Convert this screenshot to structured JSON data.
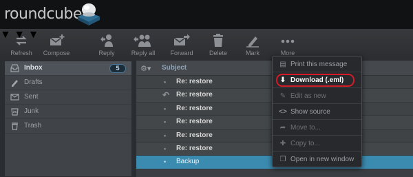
{
  "header": {
    "logo_text": "roundcube"
  },
  "toolbar": {
    "buttons": [
      {
        "label": "Refresh",
        "icon": "refresh-icon"
      },
      {
        "label": "Compose",
        "icon": "compose-icon"
      },
      {
        "label": "Reply",
        "icon": "reply-icon"
      },
      {
        "label": "Reply all",
        "icon": "reply-all-icon"
      },
      {
        "label": "Forward",
        "icon": "forward-icon"
      },
      {
        "label": "Delete",
        "icon": "trash-icon"
      },
      {
        "label": "Mark",
        "icon": "mark-icon"
      },
      {
        "label": "More",
        "icon": "more-icon"
      }
    ]
  },
  "folders": [
    {
      "label": "Inbox",
      "icon": "inbox-icon",
      "badge": "5",
      "selected": true
    },
    {
      "label": "Drafts",
      "icon": "drafts-icon"
    },
    {
      "label": "Sent",
      "icon": "sent-icon"
    },
    {
      "label": "Junk",
      "icon": "junk-icon"
    },
    {
      "label": "Trash",
      "icon": "trash-icon"
    }
  ],
  "list": {
    "header_subject": "Subject",
    "rows": [
      {
        "subject": "Re: restore",
        "icon": "dot-icon"
      },
      {
        "subject": "Re: restore",
        "icon": "replied-icon"
      },
      {
        "subject": "Re: restore",
        "icon": "dot-icon"
      },
      {
        "subject": "Re: restore",
        "icon": "dot-icon"
      },
      {
        "subject": "Re: restore",
        "icon": "dot-icon"
      },
      {
        "subject": "Re: restore",
        "icon": "dot-icon"
      },
      {
        "subject": "Backup",
        "icon": "dot-icon",
        "selected": true
      }
    ]
  },
  "more_menu": {
    "items": [
      {
        "label": "Print this message",
        "icon": "print-icon"
      },
      {
        "label": "Download (.eml)",
        "icon": "download-icon",
        "highlighted": true
      },
      {
        "label": "Edit as new",
        "icon": "edit-icon"
      },
      {
        "label": "Show source",
        "icon": "source-icon"
      },
      {
        "label": "Move to...",
        "icon": "move-icon"
      },
      {
        "label": "Copy to...",
        "icon": "copy-icon"
      },
      {
        "label": "Open in new window",
        "icon": "new-window-icon"
      }
    ]
  },
  "colors": {
    "accent": "#3b8bb0",
    "highlight_ring": "#d41c28"
  }
}
